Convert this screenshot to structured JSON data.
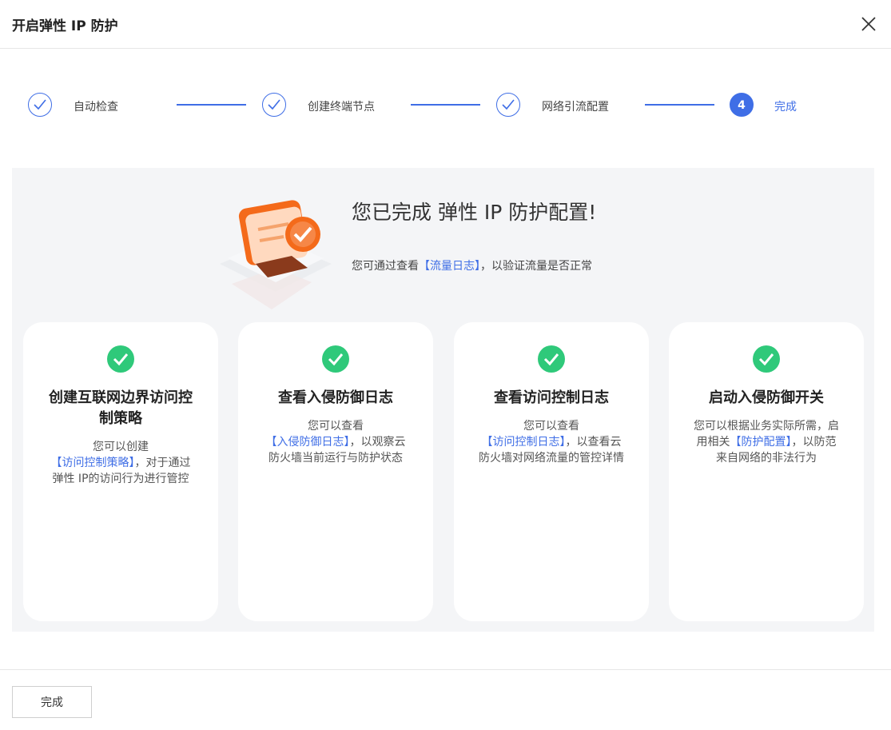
{
  "dialog": {
    "title": "开启弹性 IP 防护",
    "close_icon": "close-icon"
  },
  "steps": [
    {
      "label": "自动检查",
      "status": "done"
    },
    {
      "label": "创建终端节点",
      "status": "done"
    },
    {
      "label": "网络引流配置",
      "status": "done"
    },
    {
      "label": "完成",
      "number": "4",
      "status": "active"
    }
  ],
  "hero": {
    "title": "您已完成 弹性 IP 防护配置!",
    "sub_prefix": "您可通过查看",
    "sub_link": "【流量日志】",
    "sub_suffix": "，以验证流量是否正常"
  },
  "cards": [
    {
      "title": "创建互联网边界访问控制策略",
      "line1": "您可以创建",
      "link": "【访问控制策略】",
      "rest": "，对于通过弹性 IP的访问行为进行管控"
    },
    {
      "title": "查看入侵防御日志",
      "line1": "您可以查看",
      "link": "【入侵防御日志】",
      "rest": "，以观察云防火墙当前运行与防护状态"
    },
    {
      "title": "查看访问控制日志",
      "line1": "您可以查看",
      "link": "【访问控制日志】",
      "rest": "，以查看云防火墙对网络流量的管控详情"
    },
    {
      "title": "启动入侵防御开关",
      "line1": "您可以根据业务实际所需，启用相关",
      "link": "【防护配置】",
      "rest": "，以防范来自网络的非法行为"
    }
  ],
  "footer": {
    "done_label": "完成"
  },
  "colors": {
    "accent": "#3f6ee6",
    "success": "#2fc97a",
    "panel_bg": "#f4f5f7"
  }
}
